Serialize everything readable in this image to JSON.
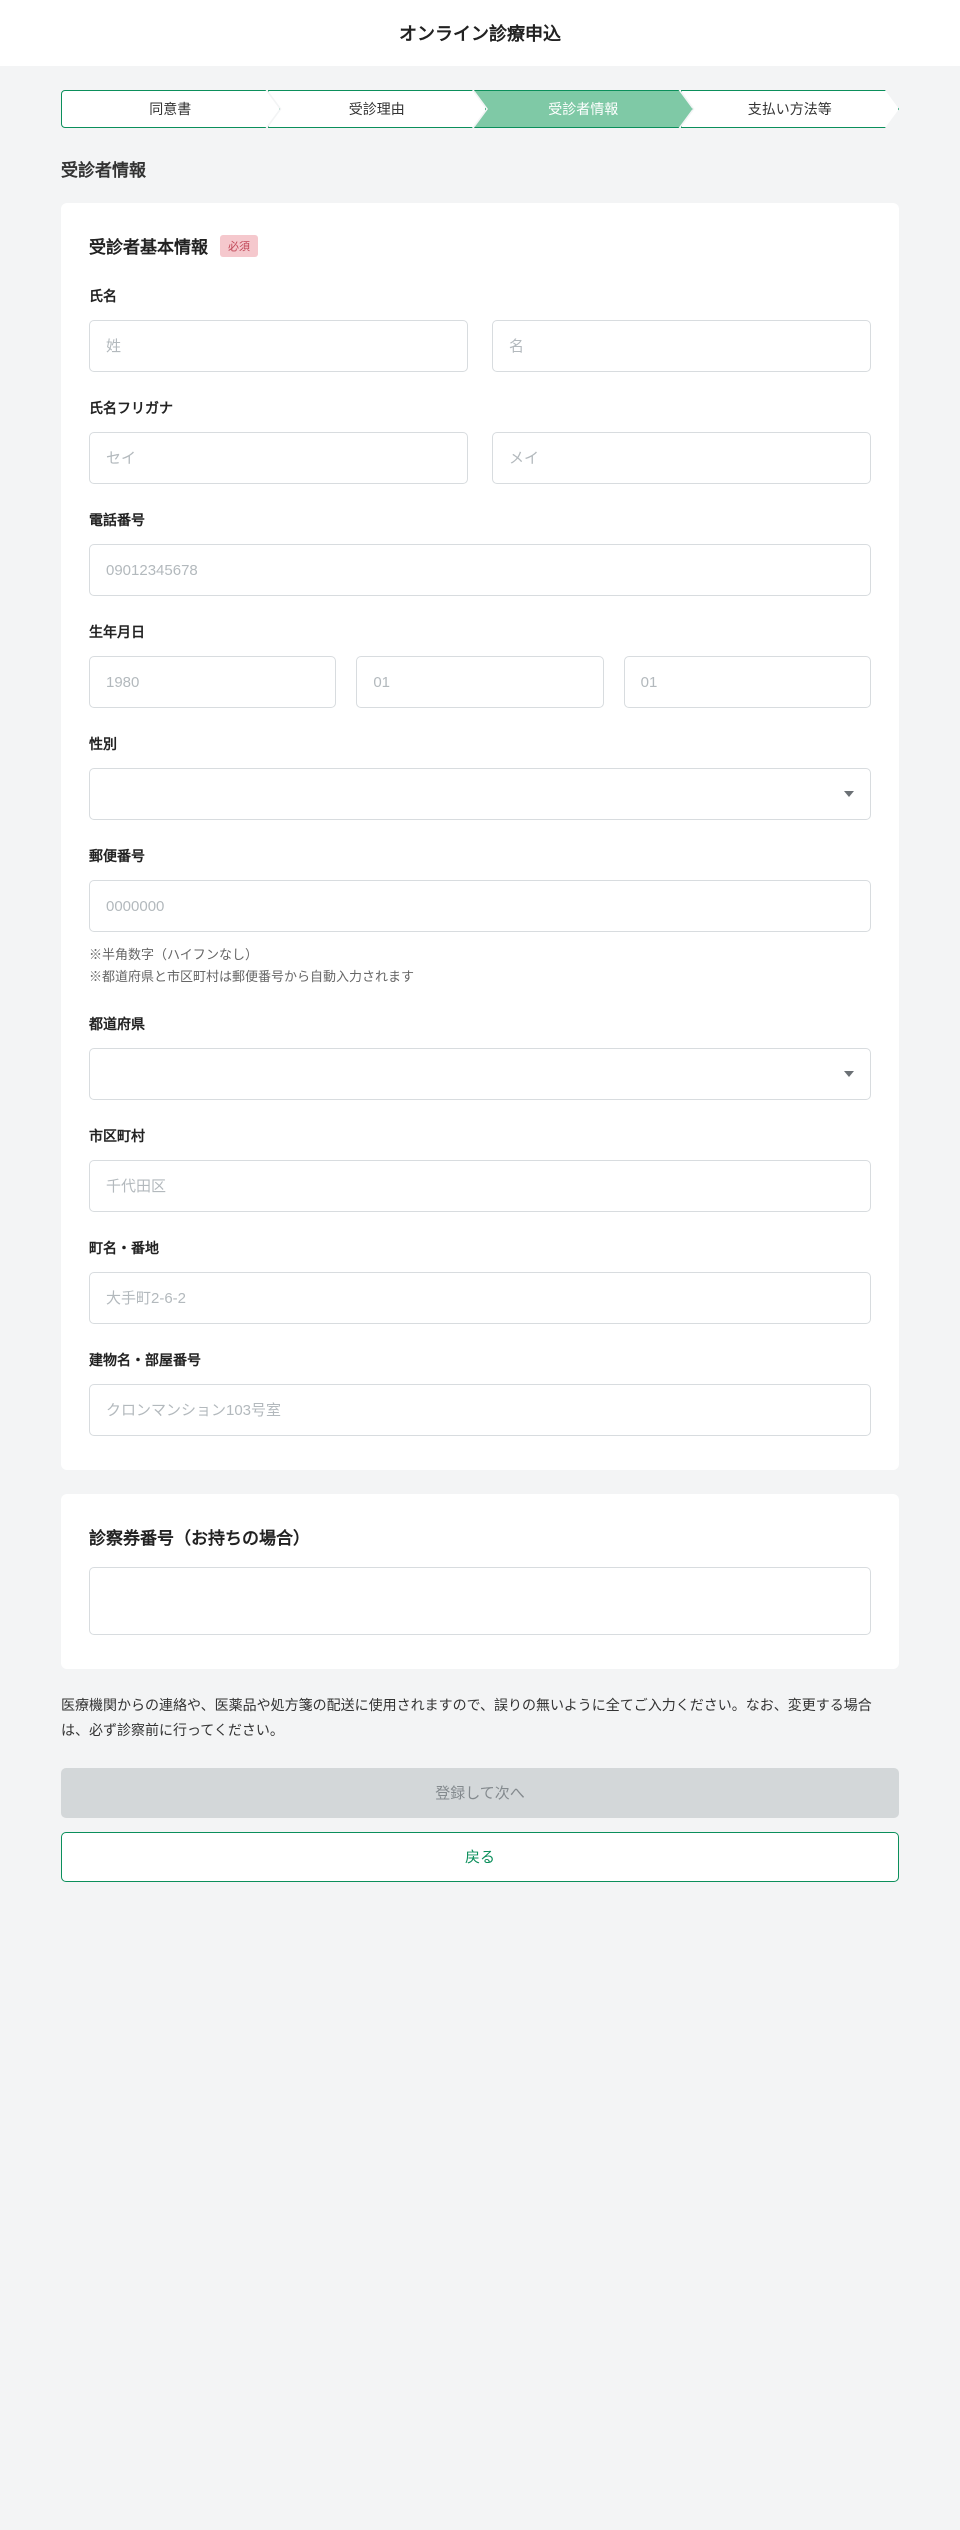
{
  "header": {
    "title": "オンライン診療申込"
  },
  "stepper": {
    "steps": [
      {
        "label": "同意書"
      },
      {
        "label": "受診理由"
      },
      {
        "label": "受診者情報"
      },
      {
        "label": "支払い方法等"
      }
    ]
  },
  "page_title": "受診者情報",
  "basic_info": {
    "section_title": "受診者基本情報",
    "required_badge": "必須",
    "fields": {
      "name_label": "氏名",
      "name_sei_placeholder": "姓",
      "name_mei_placeholder": "名",
      "kana_label": "氏名フリガナ",
      "kana_sei_placeholder": "セイ",
      "kana_mei_placeholder": "メイ",
      "phone_label": "電話番号",
      "phone_placeholder": "09012345678",
      "dob_label": "生年月日",
      "dob_year_placeholder": "1980",
      "dob_month_placeholder": "01",
      "dob_day_placeholder": "01",
      "gender_label": "性別",
      "gender_value": "",
      "postal_label": "郵便番号",
      "postal_placeholder": "0000000",
      "postal_hint1": "※半角数字（ハイフンなし）",
      "postal_hint2": "※都道府県と市区町村は郵便番号から自動入力されます",
      "prefecture_label": "都道府県",
      "prefecture_value": "",
      "city_label": "市区町村",
      "city_placeholder": "千代田区",
      "street_label": "町名・番地",
      "street_placeholder": "大手町2-6-2",
      "building_label": "建物名・部屋番号",
      "building_placeholder": "クロンマンション103号室"
    }
  },
  "patient_card": {
    "section_title": "診察券番号（お持ちの場合）"
  },
  "notice": "医療機関からの連絡や、医薬品や処方箋の配送に使用されますので、誤りの無いように全てご入力ください。なお、変更する場合は、必ず診察前に行ってください。",
  "buttons": {
    "submit": "登録して次へ",
    "back": "戻る"
  }
}
